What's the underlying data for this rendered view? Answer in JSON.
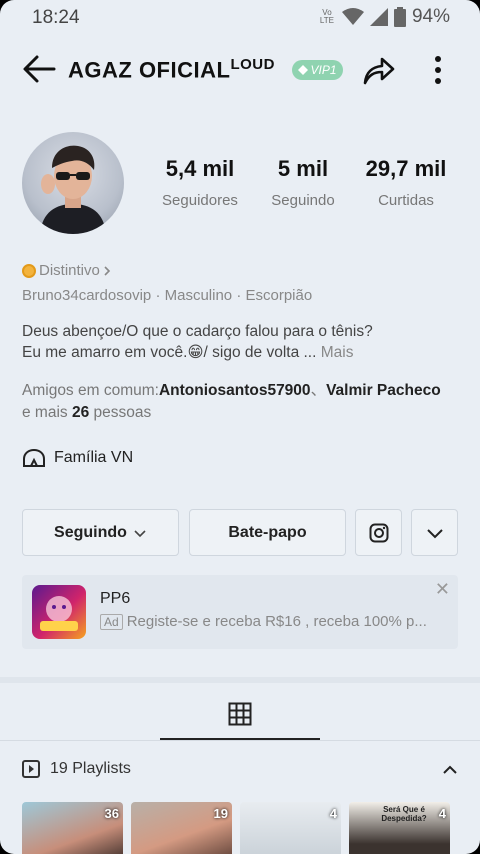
{
  "status_bar": {
    "time": "18:24",
    "network": "Vo LTE",
    "battery": "94%"
  },
  "header": {
    "display_name": "AGAZ OFICIAL",
    "name_suffix": "LOUD",
    "vip_label": "VIP1"
  },
  "stats": [
    {
      "value": "5,4 mil",
      "label": "Seguidores"
    },
    {
      "value": "5 mil",
      "label": "Seguindo"
    },
    {
      "value": "29,7 mil",
      "label": "Curtidas"
    }
  ],
  "profile": {
    "badge_label": "Distintivo",
    "username": "Bruno34cardosovip",
    "gender": "Masculino",
    "sign": "Escorpião",
    "bio_line1": "Deus abençoe/O que o cadarço falou para o tênis?",
    "bio_line2": "Eu me amarro em você.😁/ sigo de volta ...",
    "bio_more": "Mais",
    "mutual_prefix": "Amigos em comum:",
    "mutual_friend_1": "Antoniosantos57900",
    "mutual_sep": "、",
    "mutual_friend_2": "Valmir Pacheco",
    "mutual_more_prefix": "e mais",
    "mutual_more_count": "26",
    "mutual_more_suffix": "pessoas",
    "family": "Família VN"
  },
  "actions": {
    "following_label": "Seguindo",
    "chat_label": "Bate-papo"
  },
  "ad": {
    "title": "PP6",
    "tag": "Ad",
    "text": "Registe-se e receba R$16 , receba 100% p..."
  },
  "playlists": {
    "label": "19 Playlists",
    "thumbs": [
      {
        "count": "36"
      },
      {
        "count": "19"
      },
      {
        "count": "4"
      },
      {
        "count": "4"
      }
    ],
    "thumb4_caption": "Será Que é Despedida?"
  }
}
